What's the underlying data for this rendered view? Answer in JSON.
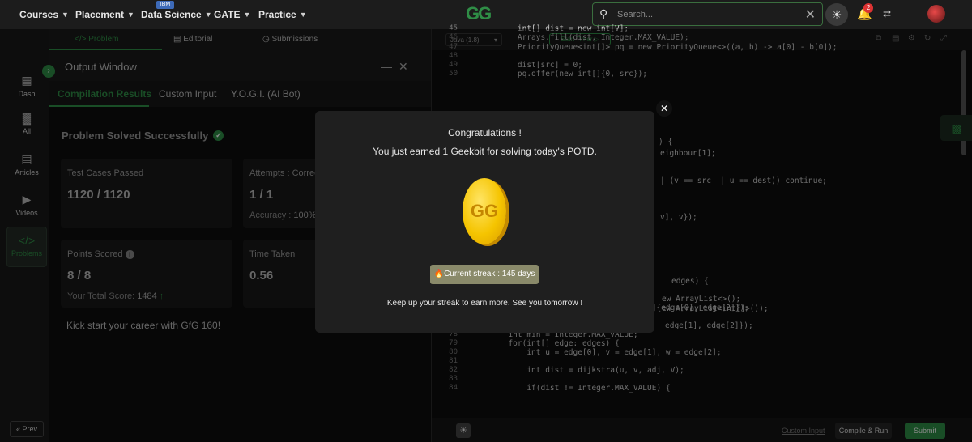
{
  "nav": {
    "items": [
      "Courses",
      "Placement",
      "Data Science",
      "GATE",
      "Practice"
    ],
    "ibm_badge": "IBM",
    "logo": "GG",
    "search_placeholder": "Search...",
    "notification_count": "2"
  },
  "sidebar": {
    "items": [
      "Dash",
      "All",
      "Articles",
      "Videos",
      "Problems"
    ],
    "prev": "Prev"
  },
  "problem_tabs": [
    "Problem",
    "Editorial",
    "Submissions"
  ],
  "output": {
    "title": "Output Window",
    "tabs": [
      "Compilation Results",
      "Custom Input",
      "Y.O.G.I. (AI Bot)"
    ],
    "solved": "Problem Solved Successfully",
    "test_label": "Test Cases Passed",
    "test_value": "1120 / 1120",
    "attempts_label": "Attempts : Correc",
    "attempts_value": "1 / 1",
    "accuracy_label": "Accuracy :",
    "accuracy_value": "100%",
    "points_label": "Points Scored",
    "points_value": "8 / 8",
    "total_label": "Your Total Score:",
    "total_value": "1484",
    "time_label": "Time Taken",
    "time_value": "0.56",
    "kick": "Kick start your career with GfG 160!"
  },
  "editor": {
    "language": "Java (1.8)",
    "timer": "Start Timer",
    "custom_input": "Custom Input",
    "compile": "Compile & Run",
    "submit": "Submit",
    "lines": [
      {
        "n": "45",
        "t": "    int[] dist = new int[V];"
      },
      {
        "n": "46",
        "t": "    Arrays.fill(dist, Integer.MAX_VALUE);"
      },
      {
        "n": "47",
        "t": "    PriorityQueue<int[]> pq = new PriorityQueue<>((a, b) -> a[0] - b[0]);"
      },
      {
        "n": "48",
        "t": ""
      },
      {
        "n": "49",
        "t": "    dist[src] = 0;"
      },
      {
        "n": "50",
        "t": "    pq.offer(new int[]{0, src});"
      },
      {
        "n": "75",
        "t": "    adj.get(edge[1]).add(new int[]{edge[0], edge[2]});"
      },
      {
        "n": "76",
        "t": "  }"
      },
      {
        "n": "77",
        "t": ""
      },
      {
        "n": "78",
        "t": "  int min = Integer.MAX_VALUE;"
      },
      {
        "n": "79",
        "t": "  for(int[] edge: edges) {"
      },
      {
        "n": "80",
        "t": "      int u = edge[0], v = edge[1], w = edge[2];"
      },
      {
        "n": "81",
        "t": ""
      },
      {
        "n": "82",
        "t": "      int dist = dijkstra(u, v, adj, V);"
      },
      {
        "n": "83",
        "t": ""
      },
      {
        "n": "84",
        "t": "      if(dist != Integer.MAX_VALUE) {"
      }
    ],
    "peek": [
      {
        "t": ") {"
      },
      {
        "t": "eighbour[1];"
      },
      {
        "t": "| (v == src || u == dest)) continue;"
      },
      {
        "t": "v], v});"
      },
      {
        "t": "edges) {"
      },
      {
        "t": "ew ArrayList<>();"
      },
      {
        "t": "ew ArrayList<int[]>());"
      },
      {
        "t": "edge[1], edge[2]});"
      }
    ]
  },
  "modal": {
    "title": "Congratulations !",
    "message": "You just earned 1 Geekbit for solving today's POTD.",
    "coin_symbol": "GG",
    "streak": "Current streak : 145 days",
    "footer": "Keep up your streak to earn more. See you tomorrow !"
  }
}
